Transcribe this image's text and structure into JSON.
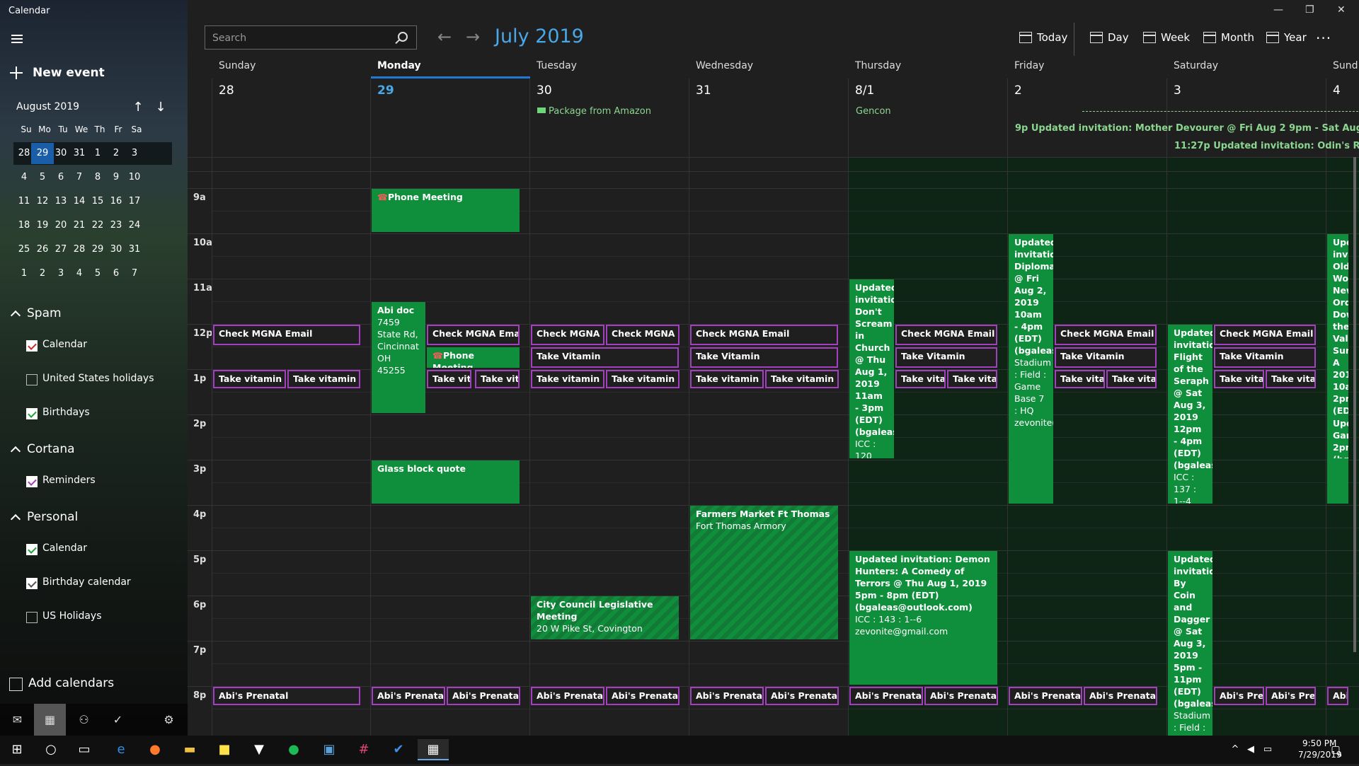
{
  "app": {
    "title": "Calendar"
  },
  "sidebar": {
    "new_event": "New event",
    "mini": {
      "title": "August 2019",
      "days": [
        "Su",
        "Mo",
        "Tu",
        "We",
        "Th",
        "Fr",
        "Sa"
      ],
      "weeks": [
        [
          "28",
          "29",
          "30",
          "31",
          "1",
          "2",
          "3"
        ],
        [
          "4",
          "5",
          "6",
          "7",
          "8",
          "9",
          "10"
        ],
        [
          "11",
          "12",
          "13",
          "14",
          "15",
          "16",
          "17"
        ],
        [
          "18",
          "19",
          "20",
          "21",
          "22",
          "23",
          "24"
        ],
        [
          "25",
          "26",
          "27",
          "28",
          "29",
          "30",
          "31"
        ],
        [
          "1",
          "2",
          "3",
          "4",
          "5",
          "6",
          "7"
        ]
      ],
      "selected_date": "29"
    },
    "groups": [
      {
        "name": "Spam",
        "items": [
          {
            "label": "Calendar",
            "checked": true,
            "color": "#d12b2b"
          },
          {
            "label": "United States holidays",
            "checked": false,
            "color": "#555555"
          },
          {
            "label": "Birthdays",
            "checked": true,
            "color": "#21a33c"
          }
        ]
      },
      {
        "name": "Cortana",
        "items": [
          {
            "label": "Reminders",
            "checked": true,
            "color": "#a43fbf"
          }
        ]
      },
      {
        "name": "Personal",
        "items": [
          {
            "label": "Calendar",
            "checked": true,
            "color": "#21a33c"
          },
          {
            "label": "Birthday calendar",
            "checked": true,
            "color": "#555555"
          },
          {
            "label": "US Holidays",
            "checked": false,
            "color": "#555555"
          }
        ]
      }
    ],
    "add_calendars": "Add calendars",
    "bottom_icons": [
      "mail-icon",
      "calendar-icon",
      "people-icon",
      "todo-icon",
      "settings-icon"
    ]
  },
  "toolbar": {
    "search_placeholder": "Search",
    "month_title": "July 2019",
    "views": [
      "Today",
      "Day",
      "Week",
      "Month",
      "Year"
    ],
    "more": "···"
  },
  "week": {
    "days": [
      {
        "name": "Sunday",
        "date": "28"
      },
      {
        "name": "Monday",
        "date": "29",
        "today": true
      },
      {
        "name": "Tuesday",
        "date": "30"
      },
      {
        "name": "Wednesday",
        "date": "31"
      },
      {
        "name": "Thursday",
        "date": "8/1"
      },
      {
        "name": "Friday",
        "date": "2"
      },
      {
        "name": "Saturday",
        "date": "3"
      },
      {
        "name": "Sund",
        "date": "4"
      }
    ],
    "allday": {
      "package": "Package from Amazon",
      "gencon": "Gencon",
      "invite1": "9p Updated invitation: Mother Devourer @ Fri Aug 2 9pm - Sat Aug 3, 2019",
      "invite2": "11:27p Updated invitation: Odin's Redux @ S"
    },
    "hours": [
      "9a",
      "10a",
      "11a",
      "12p",
      "1p",
      "2p",
      "3p",
      "4p",
      "5p",
      "6p",
      "7p",
      "8p"
    ]
  },
  "events": [
    {
      "text": "Phone Meeting",
      "col": 1,
      "start": 9,
      "end": 10,
      "type": "green",
      "icon": "phone"
    },
    {
      "text": "Abi doc",
      "sub": "7459 State Rd, Cincinnat OH 45255",
      "col": 1,
      "start": 11.5,
      "end": 14,
      "type": "green",
      "sl": 0,
      "sw": 0.37
    },
    {
      "text": "Check MGNA Email",
      "col": 1,
      "start": 12,
      "end": 12.5,
      "type": "purple",
      "sl": 0.37,
      "sw": 0.63
    },
    {
      "text": "Phone Meeting",
      "col": 1,
      "start": 12.5,
      "end": 13,
      "type": "green",
      "icon": "phone",
      "sl": 0.37,
      "sw": 0.63
    },
    {
      "text": "Take vita",
      "col": 1,
      "start": 13,
      "end": 13.45,
      "type": "purple",
      "sl": 0.37,
      "sw": 0.31
    },
    {
      "text": "Take vita",
      "col": 1,
      "start": 13,
      "end": 13.45,
      "type": "purple",
      "sl": 0.69,
      "sw": 0.31
    },
    {
      "text": "Glass block quote",
      "col": 1,
      "start": 15,
      "end": 16,
      "type": "green"
    },
    {
      "text": "Abi's Prenatal",
      "col": 1,
      "start": 20,
      "end": 20.45,
      "type": "purple",
      "sl": 0,
      "sw": 0.5
    },
    {
      "text": "Abi's Prenatal",
      "col": 1,
      "start": 20,
      "end": 20.45,
      "type": "purple",
      "sl": 0.5,
      "sw": 0.5
    },
    {
      "text": "Check MGNA Email",
      "col": 0,
      "start": 12,
      "end": 12.5,
      "type": "purple"
    },
    {
      "text": "Take vitamin",
      "col": 0,
      "start": 13,
      "end": 13.45,
      "type": "purple",
      "sl": 0,
      "sw": 0.5
    },
    {
      "text": "Take vitamin",
      "col": 0,
      "start": 13,
      "end": 13.45,
      "type": "purple",
      "sl": 0.5,
      "sw": 0.5
    },
    {
      "text": "Abi's Prenatal",
      "col": 0,
      "start": 20,
      "end": 20.45,
      "type": "purple"
    },
    {
      "text": "Check MGNA E",
      "col": 2,
      "start": 12,
      "end": 12.5,
      "type": "purple",
      "sl": 0,
      "sw": 0.5
    },
    {
      "text": "Check MGNA E",
      "col": 2,
      "start": 12,
      "end": 12.5,
      "type": "purple",
      "sl": 0.5,
      "sw": 0.5
    },
    {
      "text": "Take Vitamin",
      "col": 2,
      "start": 12.5,
      "end": 13,
      "type": "purple"
    },
    {
      "text": "Take vitamin",
      "col": 2,
      "start": 13,
      "end": 13.45,
      "type": "purple",
      "sl": 0,
      "sw": 0.5
    },
    {
      "text": "Take vitamin",
      "col": 2,
      "start": 13,
      "end": 13.45,
      "type": "purple",
      "sl": 0.5,
      "sw": 0.5
    },
    {
      "text": "City Council Legislative Meeting",
      "sub": "20 W Pike St, Covington",
      "col": 2,
      "start": 18,
      "end": 19,
      "type": "stripe"
    },
    {
      "text": "Abi's Prenatal",
      "col": 2,
      "start": 20,
      "end": 20.45,
      "type": "purple",
      "sl": 0,
      "sw": 0.5
    },
    {
      "text": "Abi's Prenatal",
      "col": 2,
      "start": 20,
      "end": 20.45,
      "type": "purple",
      "sl": 0.5,
      "sw": 0.5
    },
    {
      "text": "Check MGNA Email",
      "col": 3,
      "start": 12,
      "end": 12.5,
      "type": "purple"
    },
    {
      "text": "Take Vitamin",
      "col": 3,
      "start": 12.5,
      "end": 13,
      "type": "purple"
    },
    {
      "text": "Take vitamin",
      "col": 3,
      "start": 13,
      "end": 13.45,
      "type": "purple",
      "sl": 0,
      "sw": 0.5
    },
    {
      "text": "Take vitamin",
      "col": 3,
      "start": 13,
      "end": 13.45,
      "type": "purple",
      "sl": 0.5,
      "sw": 0.5
    },
    {
      "text": "Farmers Market Ft Thomas",
      "sub": "Fort Thomas Armory",
      "col": 3,
      "start": 16,
      "end": 19,
      "type": "stripe"
    },
    {
      "text": "Abi's Prenatal",
      "col": 3,
      "start": 20,
      "end": 20.45,
      "type": "purple",
      "sl": 0,
      "sw": 0.5
    },
    {
      "text": "Abi's Prenatal",
      "col": 3,
      "start": 20,
      "end": 20.45,
      "type": "purple",
      "sl": 0.5,
      "sw": 0.5
    },
    {
      "text": "Updated invitatio Don't Scream in Church @ Thu Aug 1, 2019 11am - 3pm (EDT) (bgaleas",
      "sub": "ICC : 120",
      "col": 4,
      "start": 11,
      "end": 15,
      "type": "green",
      "sl": 0,
      "sw": 0.31
    },
    {
      "text": "Check MGNA Email",
      "col": 4,
      "start": 12,
      "end": 12.5,
      "type": "purple",
      "sl": 0.31,
      "sw": 0.69
    },
    {
      "text": "Take Vitamin",
      "col": 4,
      "start": 12.5,
      "end": 13,
      "type": "purple",
      "sl": 0.31,
      "sw": 0.69
    },
    {
      "text": "Take vita",
      "col": 4,
      "start": 13,
      "end": 13.45,
      "type": "purple",
      "sl": 0.31,
      "sw": 0.345
    },
    {
      "text": "Take vita",
      "col": 4,
      "start": 13,
      "end": 13.45,
      "type": "purple",
      "sl": 0.655,
      "sw": 0.345
    },
    {
      "text": "Updated invitation: Demon Hunters: A Comedy of Terrors @ Thu Aug 1, 2019 5pm - 8pm (EDT) (bgaleas@outlook.com)",
      "sub": "ICC : 143 : 1--6\nzevonite@gmail.com",
      "col": 4,
      "start": 17,
      "end": 20,
      "type": "green"
    },
    {
      "text": "Abi's Prenatal",
      "col": 4,
      "start": 20,
      "end": 20.45,
      "type": "purple",
      "sl": 0,
      "sw": 0.5
    },
    {
      "text": "Abi's Prenatal",
      "col": 4,
      "start": 20,
      "end": 20.45,
      "type": "purple",
      "sl": 0.5,
      "sw": 0.5
    },
    {
      "text": "Updated invitatio Diploma @ Fri Aug 2, 2019 10am - 4pm (EDT) (bgaleas",
      "sub": "Stadium : Field : Game Base 7 : HQ zevonite(",
      "col": 5,
      "start": 10,
      "end": 16,
      "type": "green",
      "sl": 0,
      "sw": 0.31
    },
    {
      "text": "Check MGNA Email",
      "col": 5,
      "start": 12,
      "end": 12.5,
      "type": "purple",
      "sl": 0.31,
      "sw": 0.69
    },
    {
      "text": "Take Vitamin",
      "col": 5,
      "start": 12.5,
      "end": 13,
      "type": "purple",
      "sl": 0.31,
      "sw": 0.69
    },
    {
      "text": "Take vita",
      "col": 5,
      "start": 13,
      "end": 13.45,
      "type": "purple",
      "sl": 0.31,
      "sw": 0.345
    },
    {
      "text": "Take vita",
      "col": 5,
      "start": 13,
      "end": 13.45,
      "type": "purple",
      "sl": 0.655,
      "sw": 0.345
    },
    {
      "text": "Abi's Prenatal",
      "col": 5,
      "start": 20,
      "end": 20.45,
      "type": "purple",
      "sl": 0,
      "sw": 0.5
    },
    {
      "text": "Abi's Prenatal",
      "col": 5,
      "start": 20,
      "end": 20.45,
      "type": "purple",
      "sl": 0.5,
      "sw": 0.5
    },
    {
      "text": "Updated invitatio Flight of the Seraph @ Sat Aug 3, 2019 12pm - 4pm (EDT) (bgaleas",
      "sub": "ICC : 137 : 1--4",
      "col": 6,
      "start": 12,
      "end": 16,
      "type": "green",
      "sl": 0,
      "sw": 0.31
    },
    {
      "text": "Check MGNA Email",
      "col": 6,
      "start": 12,
      "end": 12.5,
      "type": "purple",
      "sl": 0.31,
      "sw": 0.69
    },
    {
      "text": "Take Vitamin",
      "col": 6,
      "start": 12.5,
      "end": 13,
      "type": "purple",
      "sl": 0.31,
      "sw": 0.69
    },
    {
      "text": "Take vita",
      "col": 6,
      "start": 13,
      "end": 13.45,
      "type": "purple",
      "sl": 0.31,
      "sw": 0.345
    },
    {
      "text": "Take vita",
      "col": 6,
      "start": 13,
      "end": 13.45,
      "type": "purple",
      "sl": 0.655,
      "sw": 0.345
    },
    {
      "text": "Updated invitatio By Coin and Dagger @ Sat Aug 3, 2019 5pm - 11pm (EDT) (bgaleas",
      "sub": "Stadium : Field : Megaagr",
      "col": 6,
      "start": 17,
      "end": 21.2,
      "type": "green",
      "sl": 0,
      "sw": 0.31
    },
    {
      "text": "Abi's Pre",
      "col": 6,
      "start": 20,
      "end": 20.45,
      "type": "purple",
      "sl": 0.31,
      "sw": 0.345
    },
    {
      "text": "Abi's Pre",
      "col": 6,
      "start": 20,
      "end": 20.45,
      "type": "purple",
      "sl": 0.655,
      "sw": 0.345
    },
    {
      "text": "Upda invita Old World New Orde Down the Valle Sun A 2019 10am 2pm (EDT)",
      "col": 7,
      "start": 10,
      "end": 16,
      "type": "green"
    },
    {
      "text": "Upda Game 2pm (bgal",
      "sub": "Hyatt zevor",
      "col": 7,
      "start": 14,
      "end": 15,
      "type": "green"
    },
    {
      "text": "Abi's",
      "col": 7,
      "start": 20,
      "end": 20.45,
      "type": "purple"
    }
  ],
  "taskbar": {
    "time": "9:50 PM",
    "date": "7/29/2019",
    "notif_count": "6"
  }
}
